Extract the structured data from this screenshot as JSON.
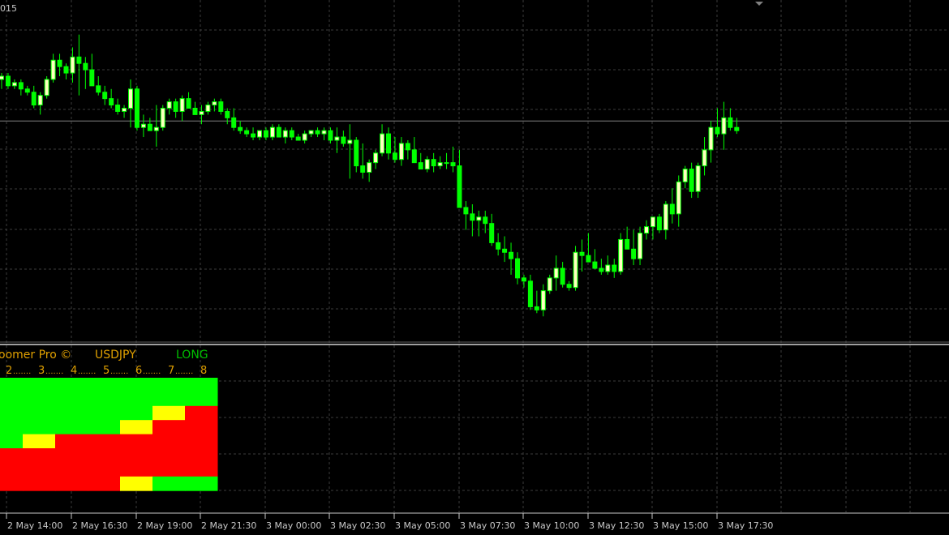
{
  "chart": {
    "corner_label": "015",
    "colors": {
      "background": "#000000",
      "grid": "#3c3c3c",
      "bull": "#ffffc0",
      "bear": "#00ff00",
      "wick": "#00ff00",
      "level": "#808080",
      "separator": "#a0a0a0",
      "text": "#c8c8c8"
    }
  },
  "chart_data": {
    "type": "candlestick",
    "title": "",
    "xlabel": "",
    "ylabel": "",
    "ylim": [
      0,
      100
    ],
    "level_line": 66,
    "x_labels": [
      "2 May 14:00",
      "2 May 16:30",
      "2 May 19:00",
      "2 May 21:30",
      "3 May 00:00",
      "3 May 02:30",
      "3 May 05:00",
      "3 May 07:30",
      "3 May 10:00",
      "3 May 12:30",
      "3 May 15:00",
      "3 May 17:30"
    ],
    "ohlc": [
      [
        79,
        81,
        76,
        80
      ],
      [
        80,
        81,
        76,
        77
      ],
      [
        77,
        79,
        76,
        78
      ],
      [
        78,
        79,
        74,
        76
      ],
      [
        76,
        77,
        74,
        75
      ],
      [
        75,
        77,
        70,
        71
      ],
      [
        71,
        75,
        68,
        74
      ],
      [
        74,
        80,
        73,
        79
      ],
      [
        79,
        87,
        78,
        85
      ],
      [
        85,
        87,
        80,
        83
      ],
      [
        83,
        84,
        79,
        81
      ],
      [
        81,
        89,
        78,
        86
      ],
      [
        86,
        93,
        74,
        84
      ],
      [
        84,
        86,
        76,
        82
      ],
      [
        82,
        87,
        78,
        77
      ],
      [
        77,
        80,
        74,
        75
      ],
      [
        75,
        77,
        71,
        73
      ],
      [
        73,
        76,
        70,
        71
      ],
      [
        71,
        73,
        68,
        69
      ],
      [
        69,
        71,
        67,
        70
      ],
      [
        70,
        79,
        64,
        76
      ],
      [
        76,
        77,
        63,
        64
      ],
      [
        64,
        68,
        61,
        65
      ],
      [
        65,
        67,
        63,
        63
      ],
      [
        63,
        71,
        58,
        64
      ],
      [
        64,
        71,
        63,
        70
      ],
      [
        70,
        73,
        68,
        72
      ],
      [
        72,
        73,
        67,
        69
      ],
      [
        69,
        74,
        66,
        73
      ],
      [
        73,
        75,
        70,
        70
      ],
      [
        70,
        72,
        68,
        68
      ],
      [
        68,
        71,
        65,
        69
      ],
      [
        69,
        72,
        68,
        71
      ],
      [
        71,
        73,
        69,
        72
      ],
      [
        72,
        73,
        68,
        69
      ],
      [
        69,
        70,
        65,
        67
      ],
      [
        67,
        70,
        63,
        64
      ],
      [
        64,
        66,
        62,
        63
      ],
      [
        63,
        64,
        61,
        62
      ],
      [
        62,
        64,
        60,
        61
      ],
      [
        61,
        63,
        60,
        63
      ],
      [
        63,
        64,
        60,
        61
      ],
      [
        61,
        65,
        60,
        64
      ],
      [
        64,
        65,
        61,
        61
      ],
      [
        61,
        64,
        59,
        63
      ],
      [
        63,
        64,
        60,
        61
      ],
      [
        61,
        62,
        60,
        60
      ],
      [
        60,
        63,
        59,
        62
      ],
      [
        62,
        63,
        61,
        63
      ],
      [
        63,
        64,
        61,
        62
      ],
      [
        62,
        64,
        60,
        63
      ],
      [
        63,
        64,
        59,
        60
      ],
      [
        60,
        64,
        56,
        61
      ],
      [
        61,
        63,
        58,
        59
      ],
      [
        59,
        65,
        48,
        60
      ],
      [
        60,
        61,
        50,
        52
      ],
      [
        52,
        59,
        48,
        50
      ],
      [
        50,
        54,
        47,
        53
      ],
      [
        53,
        57,
        51,
        56
      ],
      [
        56,
        65,
        55,
        62
      ],
      [
        62,
        64,
        54,
        56
      ],
      [
        56,
        61,
        53,
        54
      ],
      [
        54,
        61,
        52,
        59
      ],
      [
        59,
        60,
        54,
        57
      ],
      [
        57,
        61,
        54,
        53
      ],
      [
        53,
        56,
        51,
        51
      ],
      [
        51,
        55,
        50,
        54
      ],
      [
        54,
        56,
        50,
        52
      ],
      [
        52,
        55,
        51,
        53
      ],
      [
        53,
        56,
        51,
        53
      ],
      [
        53,
        58,
        50,
        52
      ],
      [
        52,
        57,
        48,
        39
      ],
      [
        39,
        41,
        32,
        37
      ],
      [
        37,
        40,
        30,
        35
      ],
      [
        35,
        38,
        30,
        36
      ],
      [
        36,
        38,
        31,
        34
      ],
      [
        34,
        37,
        27,
        28
      ],
      [
        28,
        31,
        24,
        26
      ],
      [
        26,
        30,
        22,
        25
      ],
      [
        25,
        28,
        18,
        23
      ],
      [
        23,
        25,
        15,
        17
      ],
      [
        17,
        18,
        14,
        16
      ],
      [
        16,
        18,
        7,
        8
      ],
      [
        8,
        13,
        6,
        7
      ],
      [
        7,
        15,
        5,
        13
      ],
      [
        13,
        18,
        12,
        17
      ],
      [
        17,
        24,
        13,
        20
      ],
      [
        20,
        22,
        14,
        15
      ],
      [
        15,
        16,
        13,
        14
      ],
      [
        14,
        27,
        13,
        25
      ],
      [
        25,
        29,
        19,
        24
      ],
      [
        24,
        31,
        22,
        22
      ],
      [
        22,
        26,
        20,
        20
      ],
      [
        20,
        23,
        18,
        19
      ],
      [
        19,
        24,
        18,
        21
      ],
      [
        21,
        23,
        17,
        19
      ],
      [
        19,
        31,
        18,
        29
      ],
      [
        29,
        33,
        26,
        26
      ],
      [
        26,
        32,
        21,
        23
      ],
      [
        23,
        33,
        21,
        31
      ],
      [
        31,
        35,
        29,
        33
      ],
      [
        33,
        36,
        29,
        36
      ],
      [
        36,
        37,
        31,
        32
      ],
      [
        32,
        41,
        29,
        40
      ],
      [
        40,
        45,
        34,
        37
      ],
      [
        37,
        49,
        33,
        47
      ],
      [
        47,
        52,
        45,
        51
      ],
      [
        51,
        53,
        42,
        44
      ],
      [
        44,
        53,
        42,
        52
      ],
      [
        52,
        61,
        49,
        57
      ],
      [
        57,
        66,
        53,
        64
      ],
      [
        64,
        70,
        61,
        62
      ],
      [
        62,
        72,
        57,
        67
      ],
      [
        67,
        70,
        63,
        64
      ],
      [
        64,
        67,
        62,
        63
      ]
    ]
  },
  "panel": {
    "indicator_name": "oomer Pro ©",
    "symbol": "USDJPY",
    "signal": "LONG",
    "columns": [
      "2",
      "3",
      "4",
      "5",
      "6",
      "7",
      "8"
    ],
    "colors": {
      "name": "#e0a000",
      "symbol": "#e0a000",
      "signal": "#00c000",
      "columns": "#e0a000",
      "green": "#00ff00",
      "red": "#ff0000",
      "yellow": "#ffff00"
    },
    "heatmap": {
      "type": "heatmap",
      "values": [
        [
          "g",
          "g",
          "g",
          "g",
          "g",
          "g",
          "g"
        ],
        [
          "g",
          "g",
          "g",
          "g",
          "g",
          "g",
          "g"
        ],
        [
          "g",
          "g",
          "g",
          "g",
          "g",
          "y",
          "r"
        ],
        [
          "g",
          "g",
          "g",
          "g",
          "y",
          "r",
          "r"
        ],
        [
          "g",
          "y",
          "r",
          "r",
          "r",
          "r",
          "r"
        ],
        [
          "r",
          "r",
          "r",
          "r",
          "r",
          "r",
          "r"
        ],
        [
          "r",
          "r",
          "r",
          "r",
          "r",
          "r",
          "r"
        ],
        [
          "r",
          "r",
          "r",
          "r",
          "y",
          "g",
          "g"
        ]
      ]
    }
  }
}
